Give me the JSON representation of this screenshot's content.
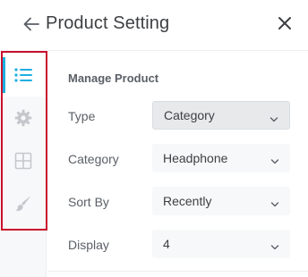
{
  "header": {
    "title": "Product Setting",
    "back_icon": "arrow-left-icon",
    "close_icon": "close-icon"
  },
  "sidebar": {
    "items": [
      {
        "icon": "list-icon",
        "active": true
      },
      {
        "icon": "gear-icon",
        "active": false
      },
      {
        "icon": "grid-icon",
        "active": false
      },
      {
        "icon": "brush-icon",
        "active": false
      }
    ]
  },
  "panel": {
    "section_title": "Manage Product",
    "fields": [
      {
        "label": "Type",
        "value": "Category"
      },
      {
        "label": "Category",
        "value": "Headphone"
      },
      {
        "label": "Sort By",
        "value": "Recently"
      },
      {
        "label": "Display",
        "value": "4"
      }
    ]
  },
  "colors": {
    "accent": "#1eaee0",
    "frame": "#c8102e",
    "rail_bg": "#f7f8f9",
    "select_bg": "#f7f8f9",
    "select_active_bg": "#e7e9eb"
  }
}
